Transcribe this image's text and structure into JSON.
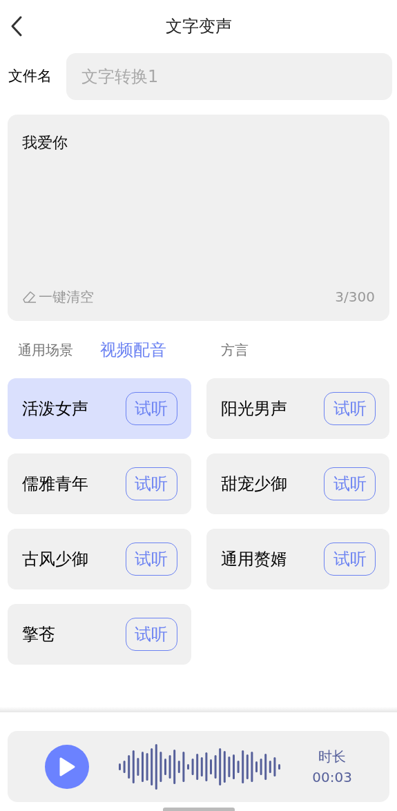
{
  "header": {
    "title": "文字变声"
  },
  "file_name": {
    "label": "文件名",
    "placeholder": "文字转换1"
  },
  "text_input": {
    "value": "我爱你",
    "clear_label": "一键清空",
    "counter": "3/300"
  },
  "tabs": [
    {
      "label": "通用场景",
      "selected": false
    },
    {
      "label": "视频配音",
      "selected": true
    },
    {
      "label": "方言",
      "selected": false
    }
  ],
  "voices": [
    {
      "name": "活泼女声",
      "preview": "试听",
      "selected": true
    },
    {
      "name": "阳光男声",
      "preview": "试听",
      "selected": false
    },
    {
      "name": "儒雅青年",
      "preview": "试听",
      "selected": false
    },
    {
      "name": "甜宠少御",
      "preview": "试听",
      "selected": false
    },
    {
      "name": "古风少御",
      "preview": "试听",
      "selected": false
    },
    {
      "name": "通用赘婿",
      "preview": "试听",
      "selected": false
    },
    {
      "name": "擎苍",
      "preview": "试听",
      "selected": false
    }
  ],
  "player": {
    "duration_label": "时长",
    "duration": "00:03"
  }
}
